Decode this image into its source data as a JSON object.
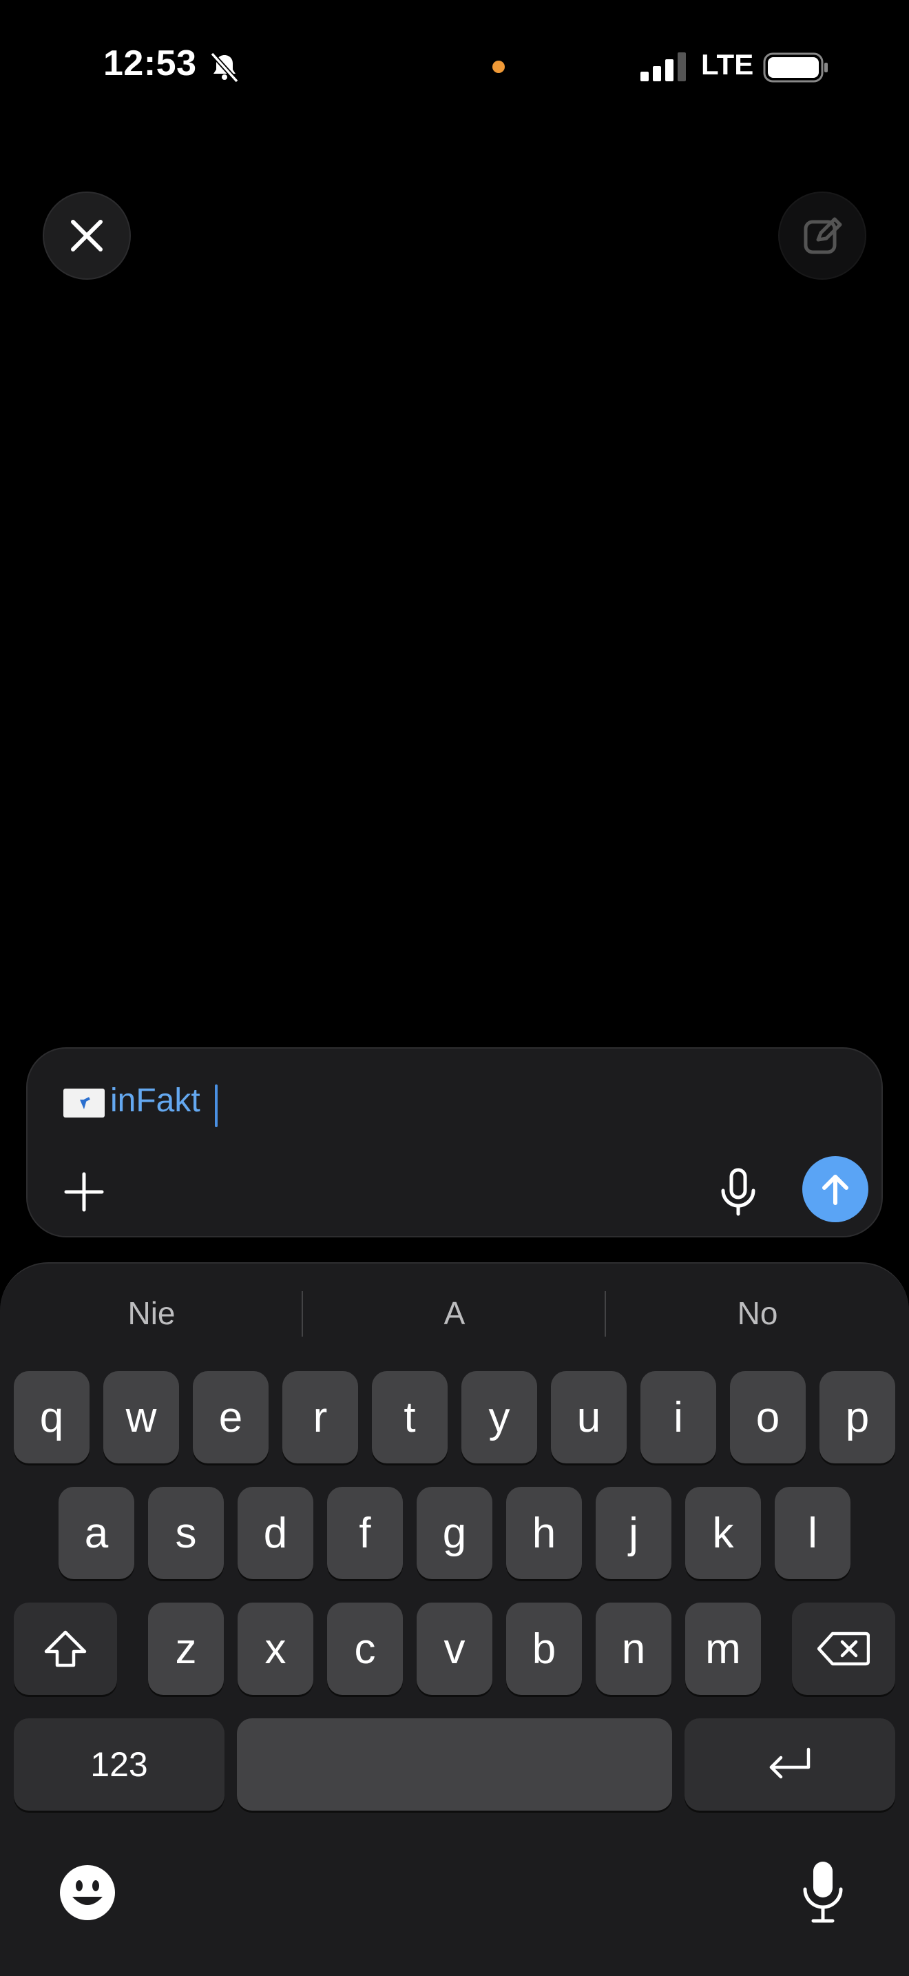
{
  "status_bar": {
    "time": "12:53",
    "network": "LTE"
  },
  "composer": {
    "token_label": "inFakt",
    "icons": {
      "plus": "plus-icon",
      "mic": "microphone-icon",
      "send": "arrow-up-icon"
    }
  },
  "header": {
    "close_icon": "close-icon",
    "edit_icon": "compose-icon"
  },
  "keyboard": {
    "suggestions": [
      "Nie",
      "A",
      "No"
    ],
    "row1": [
      "q",
      "w",
      "e",
      "r",
      "t",
      "y",
      "u",
      "i",
      "o",
      "p"
    ],
    "row2": [
      "a",
      "s",
      "d",
      "f",
      "g",
      "h",
      "j",
      "k",
      "l"
    ],
    "row3": [
      "z",
      "x",
      "c",
      "v",
      "b",
      "n",
      "m"
    ],
    "numbers_label": "123",
    "space_label": "",
    "icons": {
      "shift": "shift-icon",
      "backspace": "backspace-icon",
      "return": "return-icon",
      "emoji": "emoji-icon",
      "dictation": "microphone-icon"
    }
  },
  "colors": {
    "accent": "#5aa4f5",
    "token_text": "#64a8f0",
    "key": "#434345",
    "keyboard_bg": "#1c1c1e"
  }
}
